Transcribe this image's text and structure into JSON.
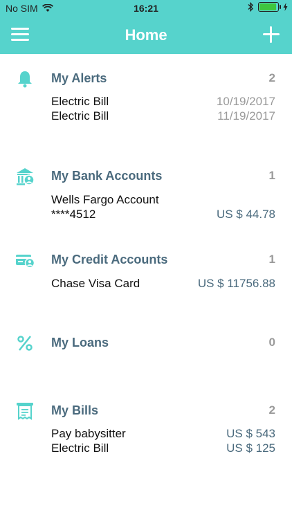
{
  "status": {
    "carrier": "No SIM",
    "time": "16:21"
  },
  "nav": {
    "title": "Home"
  },
  "colors": {
    "brand": "#56d3cc",
    "section_title": "#4a6a7d",
    "muted": "#9a9a9a"
  },
  "sections": {
    "alerts": {
      "title": "My Alerts",
      "count": "2",
      "icon": "bell-icon",
      "items": [
        {
          "label": "Electric Bill",
          "value": "10/19/2017"
        },
        {
          "label": "Electric Bill",
          "value": "11/19/2017"
        }
      ]
    },
    "bank": {
      "title": "My Bank Accounts",
      "count": "1",
      "icon": "bank-icon",
      "items": [
        {
          "label": "Wells Fargo Account",
          "sub": "****4512",
          "value": "US $ 44.78"
        }
      ]
    },
    "credit": {
      "title": "My Credit Accounts",
      "count": "1",
      "icon": "credit-card-icon",
      "items": [
        {
          "label": "Chase Visa Card",
          "value": "US $ 11756.88"
        }
      ]
    },
    "loans": {
      "title": "My Loans",
      "count": "0",
      "icon": "percent-icon"
    },
    "bills": {
      "title": "My Bills",
      "count": "2",
      "icon": "receipt-icon",
      "items": [
        {
          "label": "Pay babysitter",
          "value": "US $ 543"
        },
        {
          "label": "Electric Bill",
          "value": "US $ 125"
        }
      ]
    }
  }
}
